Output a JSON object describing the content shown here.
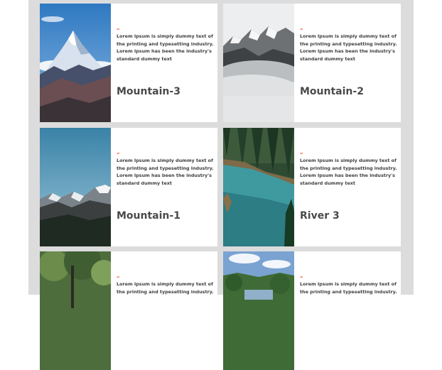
{
  "cards": [
    {
      "title": "Mountain-3",
      "quote_mark": "“",
      "description": "Lorem Ipsum is simply dummy text of the printing and typesetting industry. Lorem Ipsum has been the industry's standard dummy text",
      "image": "snowy-peak-photo"
    },
    {
      "title": "Mountain-2",
      "quote_mark": "“",
      "description": "Lorem Ipsum is simply dummy text of the printing and typesetting industry. Lorem Ipsum has been the industry's standard dummy text",
      "image": "misty-mountain-photo"
    },
    {
      "title": "Mountain-1",
      "quote_mark": "“",
      "description": "Lorem Ipsum is simply dummy text of the printing and typesetting industry. Lorem Ipsum has been the industry's standard dummy text",
      "image": "mountain-range-photo"
    },
    {
      "title": "River 3",
      "quote_mark": "“",
      "description": "Lorem Ipsum is simply dummy text of the printing and typesetting industry. Lorem Ipsum has been the industry's standard dummy text",
      "image": "forest-river-photo"
    },
    {
      "quote_mark": "“",
      "description": "Lorem Ipsum is simply dummy text of the printing and typesetting industry.",
      "image": "forest-trees-photo"
    },
    {
      "quote_mark": "“",
      "description": "Lorem Ipsum is simply dummy text of the printing and typesetting industry.",
      "image": "river-landscape-photo"
    }
  ],
  "colors": {
    "accent": "#e8572a",
    "panel_background": "#dcdcdd",
    "card_background": "#ffffff",
    "text": "#3f3f3f"
  }
}
